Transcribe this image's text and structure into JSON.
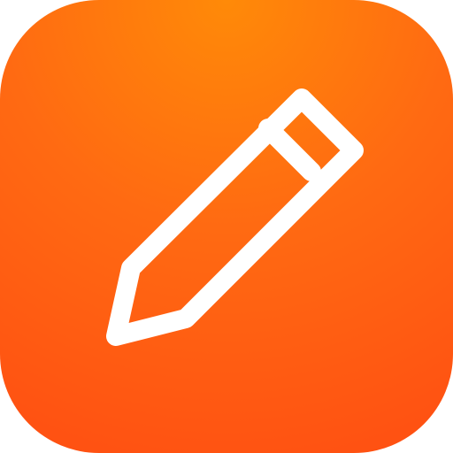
{
  "app_icon": {
    "icon_name": "pencil-icon",
    "colors": {
      "background_top": "#ff8a08",
      "background_mid": "#ff6a12",
      "background_bottom": "#ff4e12",
      "glyph": "#ffffff"
    }
  }
}
